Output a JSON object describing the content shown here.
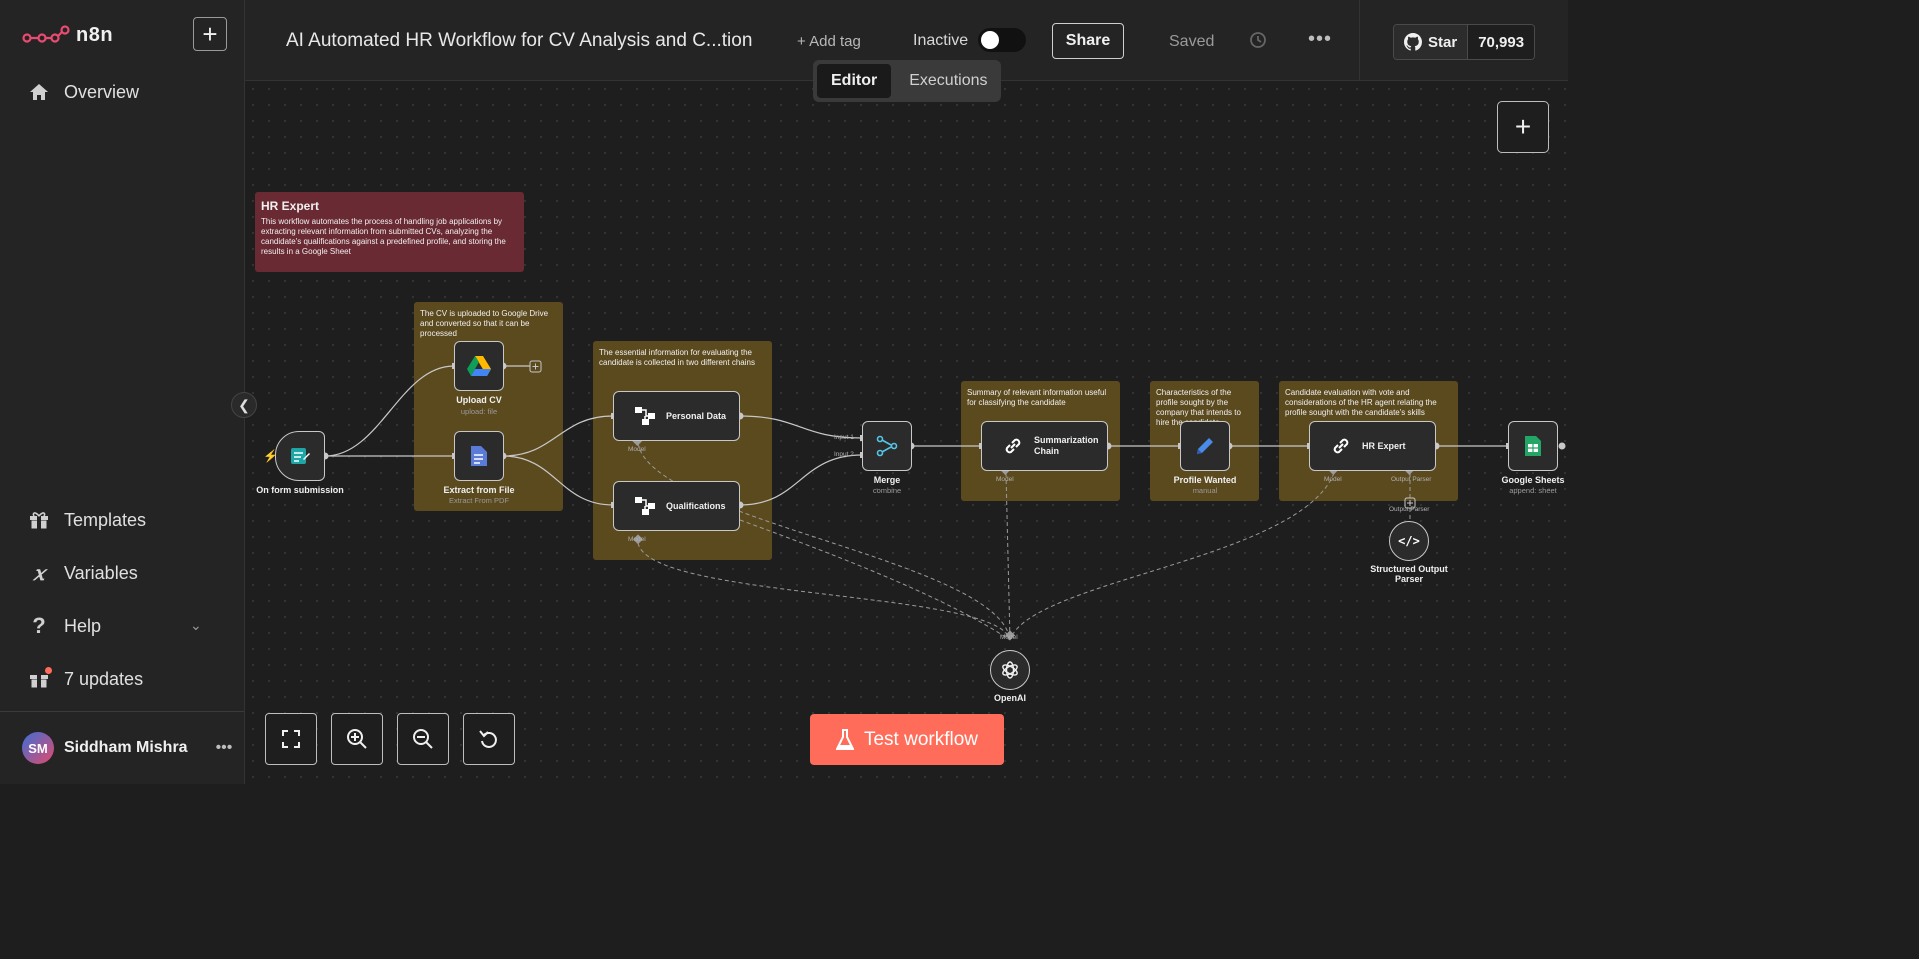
{
  "app": {
    "logo_text": "n8n"
  },
  "sidebar": {
    "new_label": "+",
    "items": [
      {
        "label": "Overview",
        "icon": "home-icon"
      },
      {
        "label": "Templates",
        "icon": "box-icon"
      },
      {
        "label": "Variables",
        "icon": "variable-icon"
      },
      {
        "label": "Help",
        "icon": "question-icon"
      },
      {
        "label": "7 updates",
        "icon": "gift-icon"
      }
    ],
    "collapse_icon": "chevron-left-icon",
    "user": {
      "initials": "SM",
      "name": "Siddham Mishra",
      "more": "•••"
    }
  },
  "header": {
    "title": "AI Automated HR Workflow for CV Analysis and C...tion",
    "add_tag": "+ Add tag",
    "status": "Inactive",
    "share": "Share",
    "saved": "Saved",
    "more": "•••",
    "github_star": "Star",
    "github_count": "70,993"
  },
  "tabs": [
    {
      "label": "Editor",
      "active": true
    },
    {
      "label": "Executions",
      "active": false
    }
  ],
  "canvas": {
    "stickies": {
      "hr_title": "HR Expert",
      "hr_body": "This workflow automates the process of handling job applications by extracting relevant information from submitted CVs, analyzing the candidate's qualifications against a predefined profile, and storing the results in a Google Sheet",
      "upload": "The CV is uploaded to Google Drive and converted so that it can be processed",
      "essential": "The essential information for evaluating the candidate is collected in two different chains",
      "summary": "Summary of relevant information useful for classifying the candidate",
      "profile": "Characteristics of the profile sought by the company that intends to hire the candidate",
      "evaluation": "Candidate evaluation with vote and considerations of the HR agent relating the profile sought with the candidate's skills"
    },
    "nodes": {
      "form": {
        "label": "On form submission"
      },
      "upload": {
        "label": "Upload CV",
        "sub": "upload: file"
      },
      "extract": {
        "label": "Extract from File",
        "sub": "Extract From PDF"
      },
      "personal": {
        "label": "Personal Data"
      },
      "qualifications": {
        "label": "Qualifications"
      },
      "merge": {
        "label": "Merge",
        "sub": "combine",
        "input1": "Input 1",
        "input2": "Input 2"
      },
      "summarization": {
        "label": "Summarization Chain"
      },
      "profile": {
        "label": "Profile Wanted",
        "sub": "manual"
      },
      "hr_expert": {
        "label": "HR Expert"
      },
      "sheets": {
        "label": "Google Sheets",
        "sub": "append: sheet"
      },
      "parser": {
        "label": "Structured Output Parser"
      },
      "openai": {
        "label": "OpenAI"
      }
    },
    "ports": {
      "model": "Model",
      "output_parser": "Output Parser"
    }
  },
  "controls": {
    "test": "Test workflow"
  },
  "colors": {
    "accent": "#ff6d5a",
    "sticky_yellow": "#5c4a1f",
    "sticky_red": "#6a2a33",
    "logo": "#ea4b71"
  }
}
